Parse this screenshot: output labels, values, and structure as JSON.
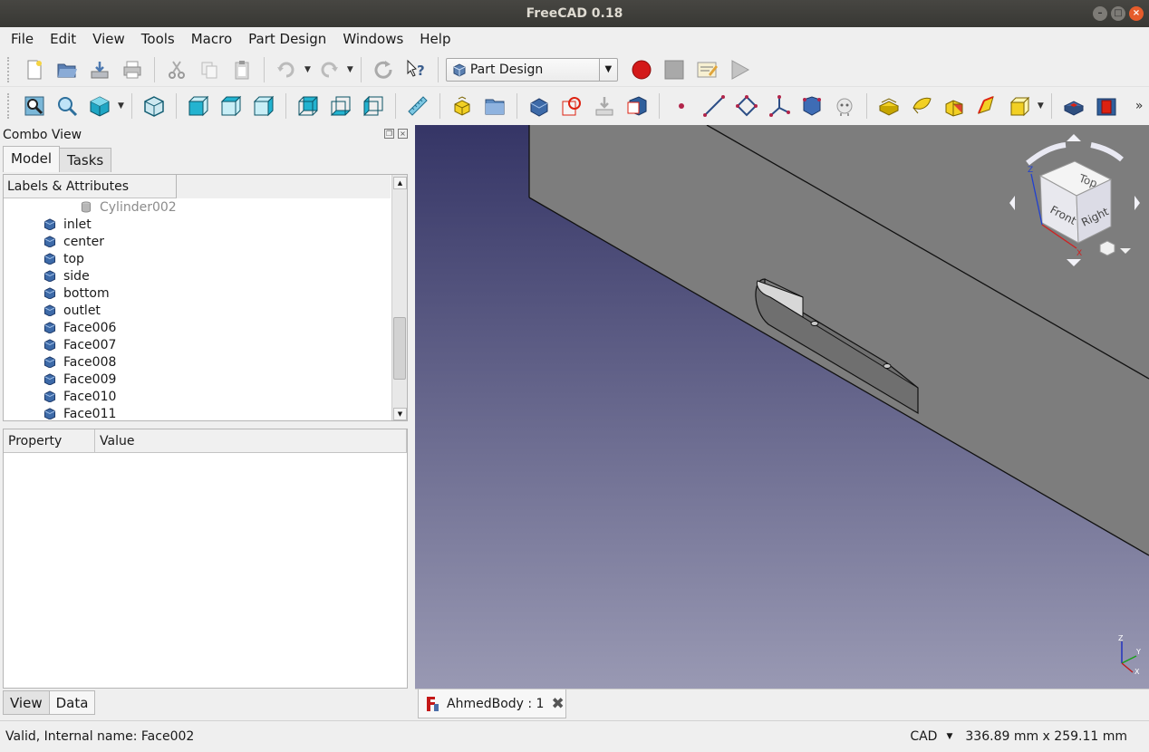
{
  "window": {
    "title": "FreeCAD 0.18"
  },
  "menubar": [
    "File",
    "Edit",
    "View",
    "Tools",
    "Macro",
    "Part Design",
    "Windows",
    "Help"
  ],
  "toolbar": {
    "workbench": "Part Design"
  },
  "combo": {
    "title": "Combo View",
    "tabs": [
      "Model",
      "Tasks"
    ],
    "tree_header": "Labels & Attributes",
    "tree_items": [
      {
        "label": "Cylinder002",
        "hidden": true
      },
      {
        "label": "inlet"
      },
      {
        "label": "center"
      },
      {
        "label": "top"
      },
      {
        "label": "side"
      },
      {
        "label": "bottom"
      },
      {
        "label": "outlet"
      },
      {
        "label": "Face006"
      },
      {
        "label": "Face007"
      },
      {
        "label": "Face008"
      },
      {
        "label": "Face009"
      },
      {
        "label": "Face010"
      },
      {
        "label": "Face011"
      }
    ],
    "prop_header_property": "Property",
    "prop_header_value": "Value",
    "bottom_tabs": [
      "View",
      "Data"
    ]
  },
  "viewport": {
    "navcube": {
      "top": "Top",
      "front": "Front",
      "right": "Right"
    },
    "axes": {
      "x": "X",
      "y": "Y",
      "z": "Z"
    }
  },
  "doc_tab": {
    "label": "AhmedBody : 1"
  },
  "status": {
    "message": "Valid, Internal name: Face002",
    "nav_style": "CAD",
    "dimensions": "336.89 mm x 259.11 mm"
  }
}
